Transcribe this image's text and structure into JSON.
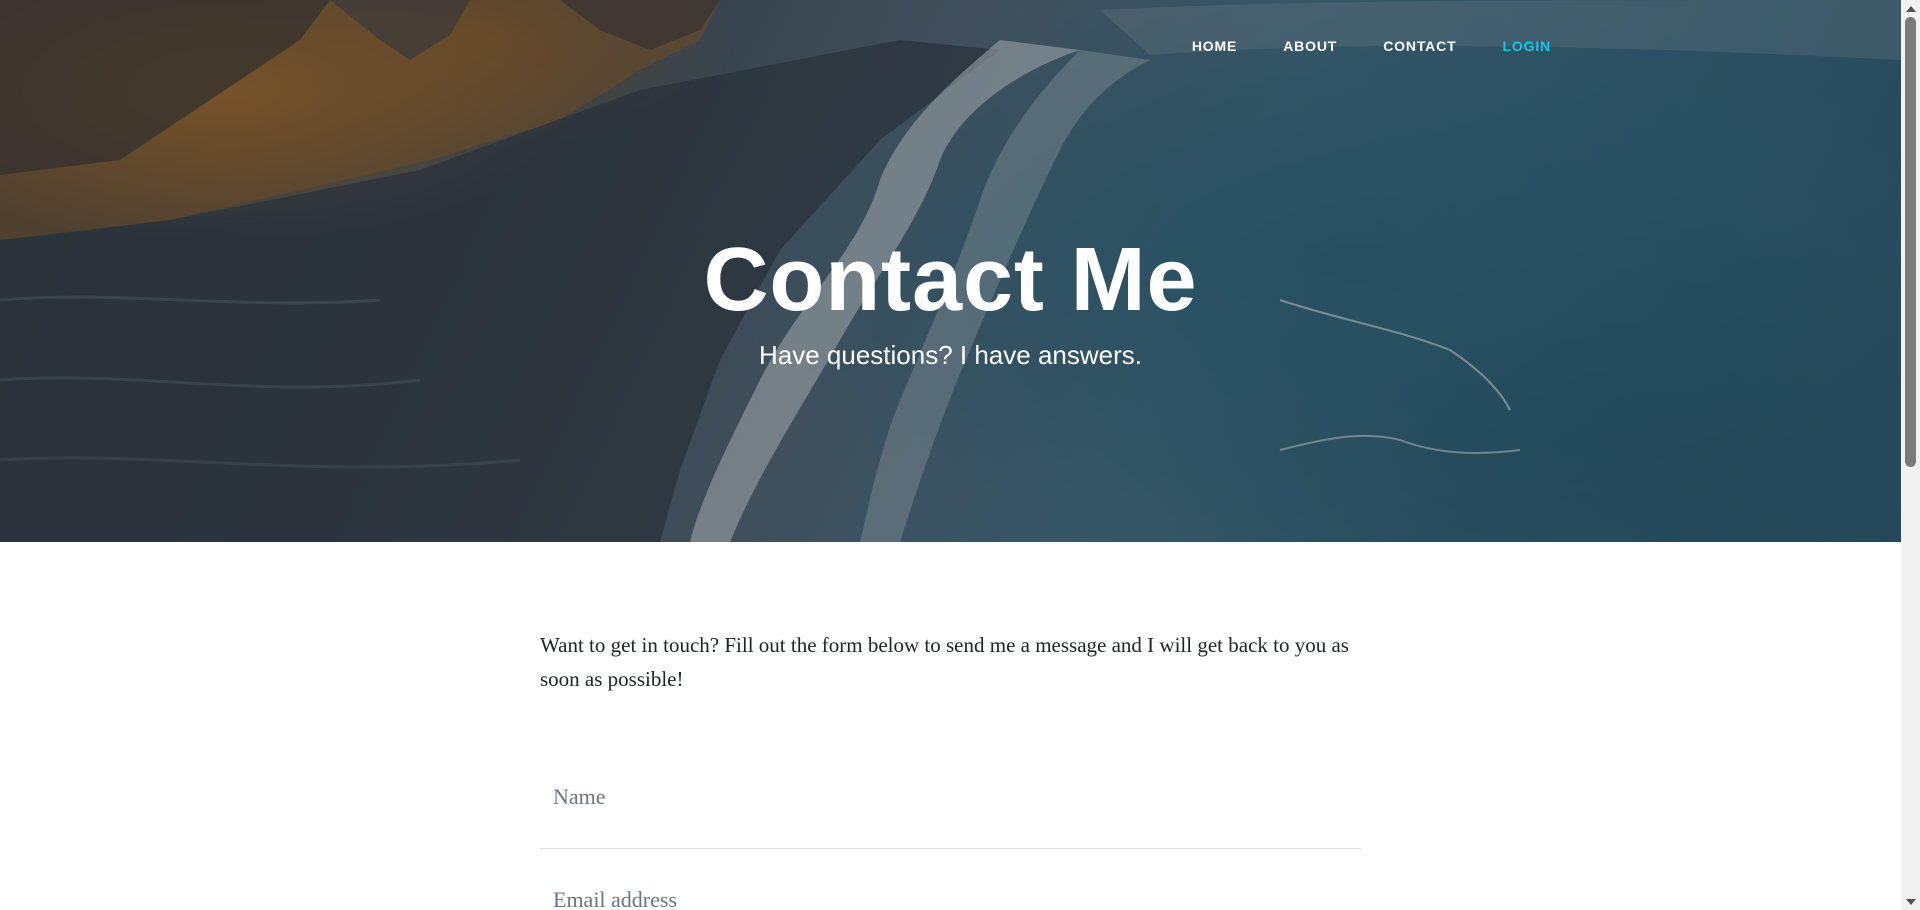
{
  "nav": {
    "items": [
      {
        "label": "HOME",
        "color": "#ffffff"
      },
      {
        "label": "ABOUT",
        "color": "#ffffff"
      },
      {
        "label": "CONTACT",
        "color": "#ffffff"
      },
      {
        "label": "LOGIN",
        "color": "#0dcaf0"
      }
    ]
  },
  "hero": {
    "title": "Contact Me",
    "subtitle": "Have questions? I have answers."
  },
  "main": {
    "intro": "Want to get in touch? Fill out the form below to send me a message and I will get back to you as soon as possible!"
  },
  "form": {
    "name_placeholder": "Name",
    "email_placeholder": "Email address"
  },
  "colors": {
    "accent": "#0dcaf0",
    "text": "#212529",
    "placeholder": "#6c757d",
    "divider": "#dee2e6"
  }
}
